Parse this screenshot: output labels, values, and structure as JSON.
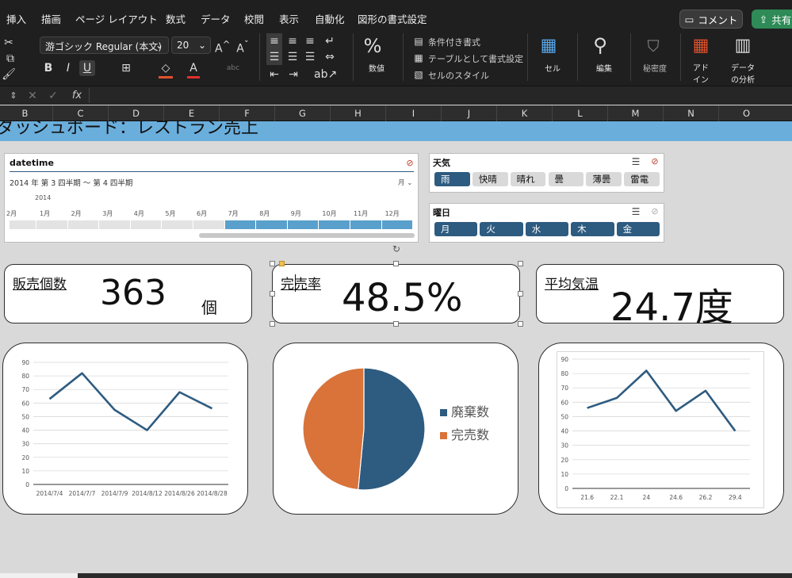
{
  "ribbon": {
    "tabs": [
      "挿入",
      "描画",
      "ページ レイアウト",
      "数式",
      "データ",
      "校閲",
      "表示",
      "自動化",
      "図形の書式設定"
    ],
    "comment_label": "コメント",
    "share_label": "共有",
    "font_name": "游ゴシック Regular (本文)",
    "font_size": "20",
    "number_label": "数値",
    "conditional_format": "条件付き書式",
    "format_as_table": "テーブルとして書式設定",
    "cell_styles": "セルのスタイル",
    "cell_label": "セル",
    "edit_label": "編集",
    "sensitivity_label": "秘密度",
    "addin_label": "アド\nイン",
    "analyze_label": "データ\nの分析"
  },
  "formula_bar": {
    "fx": "fx"
  },
  "columns": [
    "B",
    "C",
    "D",
    "E",
    "F",
    "G",
    "H",
    "I",
    "J",
    "K",
    "L",
    "M",
    "N",
    "O"
  ],
  "banner_title": "ダッシュボード：レストラン売上",
  "slicer_date": {
    "title": "datetime",
    "range": "2014 年 第 3 四半期 〜 第 4 四半期",
    "unit": "月",
    "year": "2014",
    "months": [
      "2月",
      "1月",
      "2月",
      "3月",
      "4月",
      "5月",
      "6月",
      "7月",
      "8月",
      "9月",
      "10月",
      "11月",
      "12月"
    ]
  },
  "slicer_weather": {
    "title": "天気",
    "items": [
      "雨",
      "快晴",
      "晴れ",
      "曇",
      "薄曇",
      "雷電"
    ],
    "selected": [
      "雨"
    ]
  },
  "slicer_day": {
    "title": "曜日",
    "items": [
      "月",
      "火",
      "水",
      "木",
      "金"
    ],
    "selected": [
      "月",
      "火",
      "水",
      "木",
      "金"
    ]
  },
  "kpi": {
    "sales": {
      "label": "販売個数",
      "value": "363",
      "unit": "個"
    },
    "sellout": {
      "label": "完売率",
      "value": "48.5%"
    },
    "temp": {
      "label": "平均気温",
      "value": "24.7度"
    }
  },
  "colors": {
    "line": "#2e5b80",
    "discard": "#2e5b80",
    "sold": "#d9733a",
    "banner": "#6aaedc"
  },
  "chart_data": [
    {
      "type": "line",
      "x": [
        "2014/7/4",
        "2014/7/7",
        "2014/7/9",
        "2014/8/12",
        "2014/8/26",
        "2014/8/28"
      ],
      "y": [
        63,
        82,
        55,
        40,
        68,
        56
      ],
      "ylim": [
        0,
        90
      ],
      "yticks": [
        0,
        10,
        20,
        30,
        40,
        50,
        60,
        70,
        80,
        90
      ],
      "grid": true
    },
    {
      "type": "pie",
      "labels": [
        "廃棄数",
        "完売数"
      ],
      "values": [
        51.5,
        48.5
      ],
      "legend": "right"
    },
    {
      "type": "line",
      "x": [
        "21.6",
        "22.1",
        "24",
        "24.6",
        "26.2",
        "29.4"
      ],
      "y": [
        56,
        63,
        82,
        54,
        68,
        40
      ],
      "ylim": [
        0,
        90
      ],
      "yticks": [
        0,
        10,
        20,
        30,
        40,
        50,
        60,
        70,
        80,
        90
      ],
      "grid": true
    }
  ]
}
